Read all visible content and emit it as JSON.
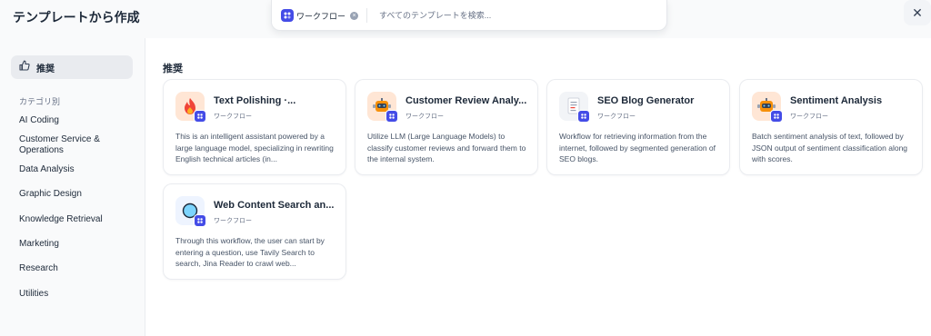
{
  "header": {
    "title": "テンプレートから作成"
  },
  "search": {
    "chip_label": "ワークフロー",
    "placeholder": "すべてのテンプレートを検索...",
    "value": ""
  },
  "close": {
    "symbol": "✕"
  },
  "sidebar": {
    "recommended_label": "推奨",
    "category_heading": "カテゴリ別",
    "categories": [
      "AI Coding",
      "Customer Service & Operations",
      "Data Analysis",
      "Graphic Design",
      "Knowledge Retrieval",
      "Marketing",
      "Research",
      "Utilities"
    ]
  },
  "main": {
    "heading": "推奨",
    "cards": [
      {
        "title": "Text Polishing ·...",
        "type": "ワークフロー",
        "description": "This is an intelligent assistant powered by a large language model, specializing in rewriting English technical articles (in...",
        "icon": "fire-icon",
        "icon_bg": "#ffe6d5"
      },
      {
        "title": "Customer Review Analy...",
        "type": "ワークフロー",
        "description": "Utilize LLM (Large Language Models) to classify customer reviews and forward them to the internal system.",
        "icon": "robot-icon",
        "icon_bg": "#ffe6d5"
      },
      {
        "title": "SEO Blog Generator",
        "type": "ワークフロー",
        "description": "Workflow for retrieving information from the internet, followed by segmented generation of SEO blogs.",
        "icon": "document-icon",
        "icon_bg": "#f2f4f7"
      },
      {
        "title": "Sentiment Analysis",
        "type": "ワークフロー",
        "description": "Batch sentiment analysis of text, followed by JSON output of sentiment classification along with scores.",
        "icon": "robot-icon",
        "icon_bg": "#ffe6d5"
      },
      {
        "title": "Web Content Search an...",
        "type": "ワークフロー",
        "description": "Through this workflow, the user can start by entering a question, use Tavily Search to search, Jina Reader to crawl web...",
        "icon": "globe-icon",
        "icon_bg": "#eef4ff"
      }
    ]
  },
  "colors": {
    "accent": "#444ce7",
    "sidebar_bg": "#f9fafb",
    "active_item_bg": "#e9ebef"
  }
}
